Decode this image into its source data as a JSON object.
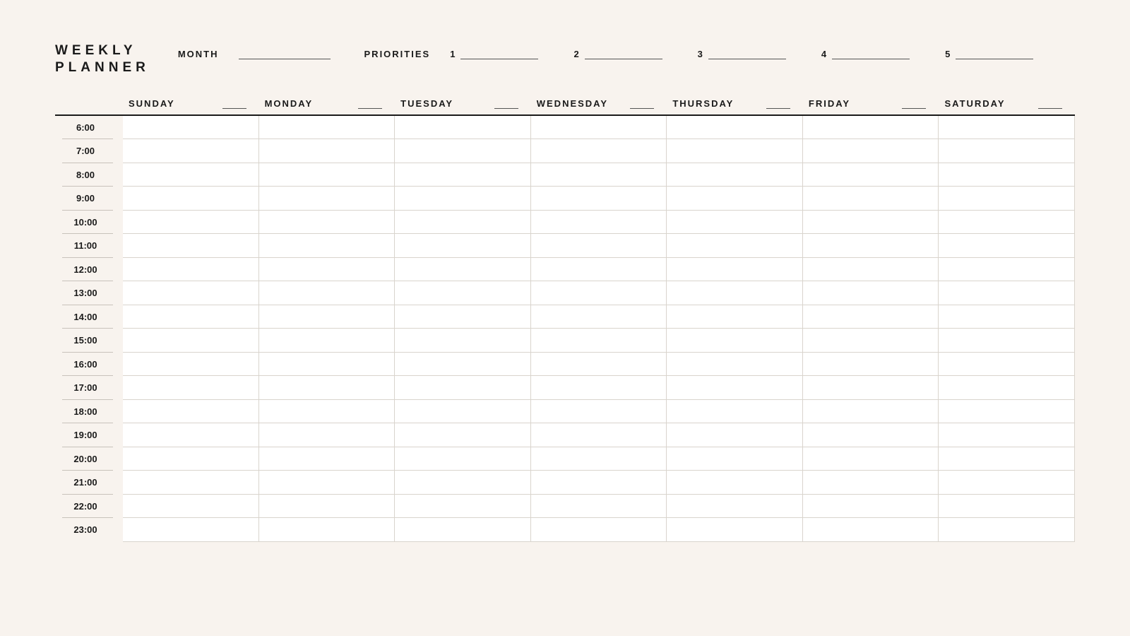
{
  "title": {
    "line1": "WEEKLY",
    "line2": "PLANNER"
  },
  "meta": {
    "month_label": "MONTH",
    "month_value": "",
    "priorities_label": "PRIORITIES",
    "priorities": [
      {
        "num": "1",
        "value": ""
      },
      {
        "num": "2",
        "value": ""
      },
      {
        "num": "3",
        "value": ""
      },
      {
        "num": "4",
        "value": ""
      },
      {
        "num": "5",
        "value": ""
      }
    ]
  },
  "days": [
    {
      "label": "SUNDAY",
      "date": ""
    },
    {
      "label": "MONDAY",
      "date": ""
    },
    {
      "label": "TUESDAY",
      "date": ""
    },
    {
      "label": "WEDNESDAY",
      "date": ""
    },
    {
      "label": "THURSDAY",
      "date": ""
    },
    {
      "label": "FRIDAY",
      "date": ""
    },
    {
      "label": "SATURDAY",
      "date": ""
    }
  ],
  "hours": [
    "6:00",
    "7:00",
    "8:00",
    "9:00",
    "10:00",
    "11:00",
    "12:00",
    "13:00",
    "14:00",
    "15:00",
    "16:00",
    "17:00",
    "18:00",
    "19:00",
    "20:00",
    "21:00",
    "22:00",
    "23:00"
  ]
}
